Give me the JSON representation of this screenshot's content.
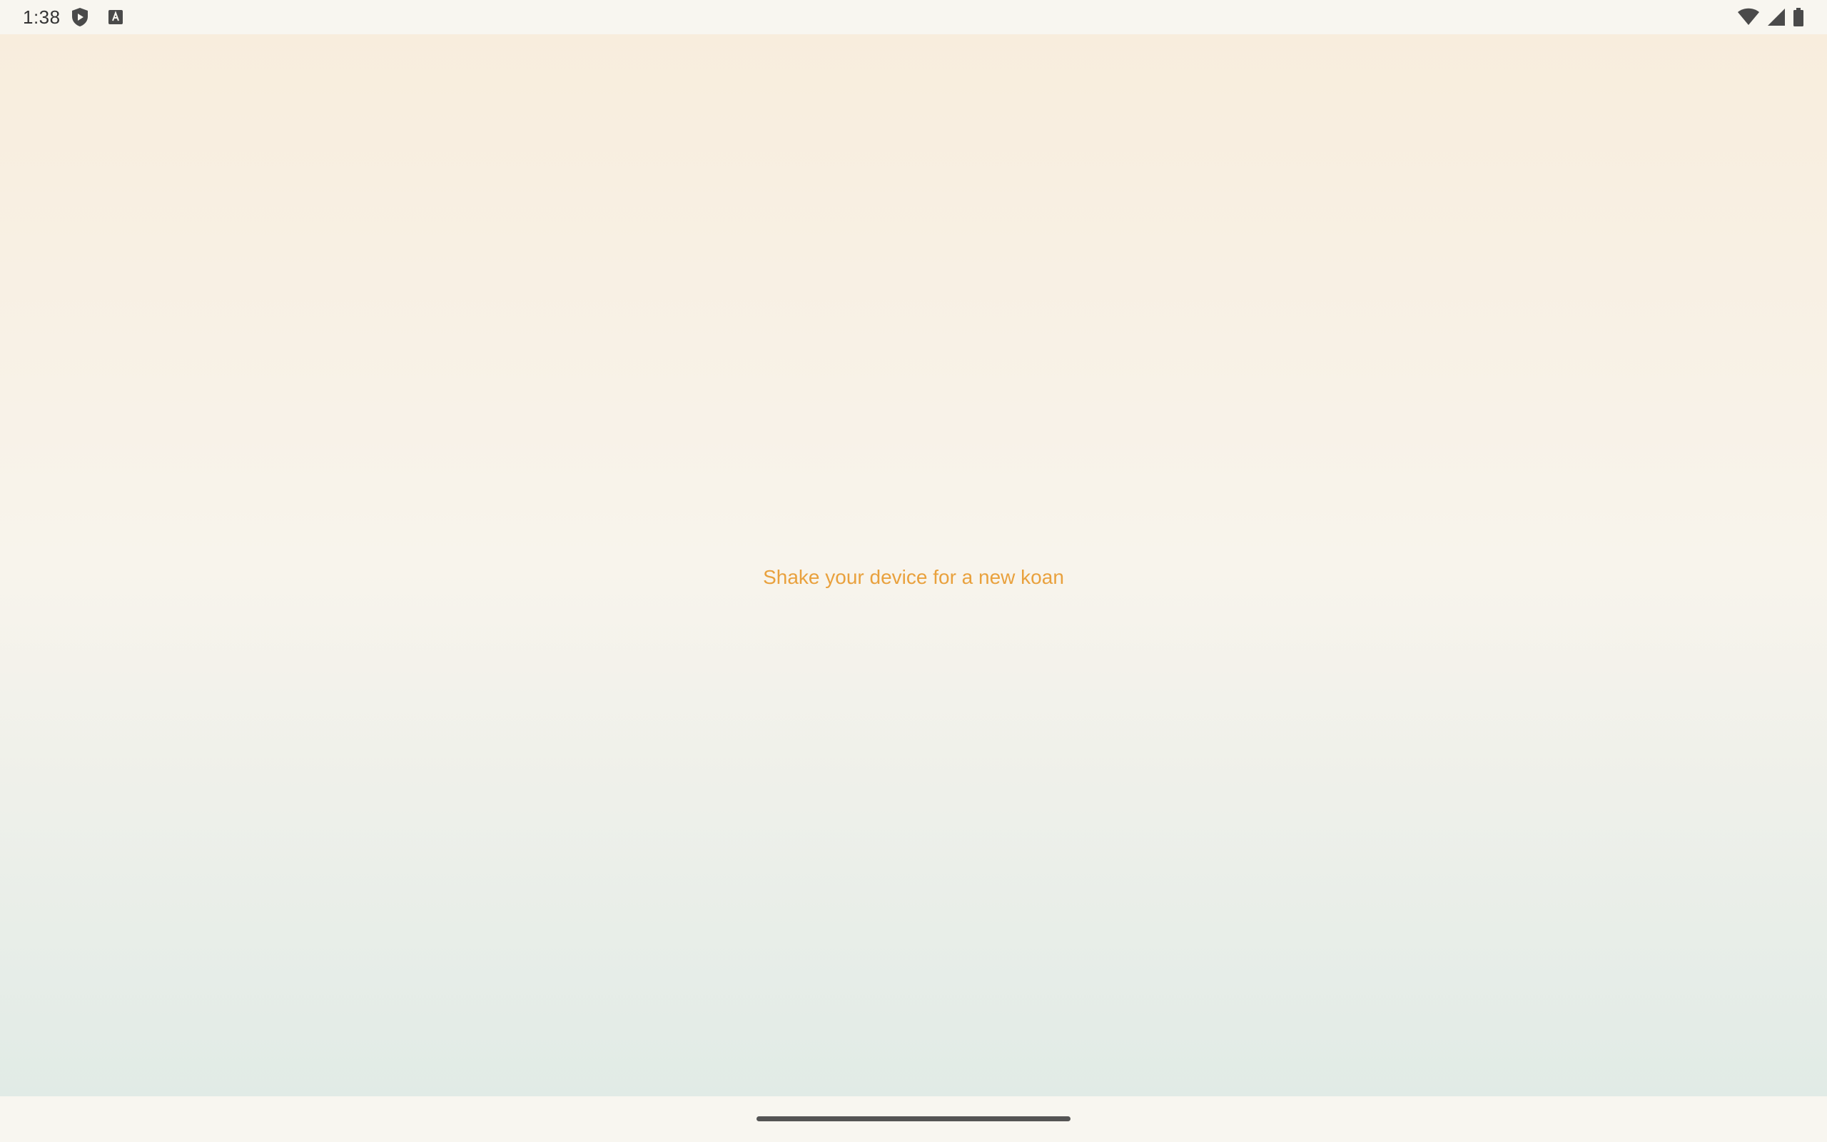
{
  "status_bar": {
    "time": "1:38",
    "left_icons": [
      "shield-play-icon",
      "keyboard-a-icon"
    ],
    "right_icons": [
      "wifi-icon",
      "cell-signal-icon",
      "battery-icon"
    ]
  },
  "main": {
    "prompt_text": "Shake your device for a new koan"
  },
  "nav": {
    "handle": "home-gesture-handle"
  },
  "colors": {
    "accent": "#e9a13d",
    "background_top": "#f8eddd",
    "background_bottom": "#e1ebe6",
    "bar_background": "#f8f6f0"
  }
}
